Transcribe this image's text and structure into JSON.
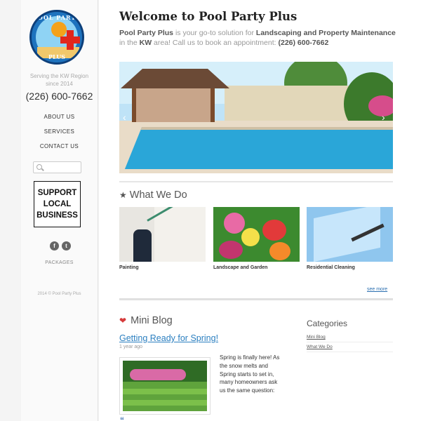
{
  "sidebar": {
    "logo": {
      "text_top": "POOL PARTY",
      "text_bottom": "PLUS"
    },
    "tagline_line1": "Serving the KW Region",
    "tagline_line2": "since 2014",
    "phone": "(226) 600-7662",
    "nav": [
      "ABOUT US",
      "SERVICES",
      "CONTACT US"
    ],
    "search_placeholder": "",
    "support_badge": [
      "SUPPORT",
      "LOCAL",
      "BUSINESS"
    ],
    "social": [
      {
        "icon": "facebook-icon",
        "glyph": "f"
      },
      {
        "icon": "twitter-icon",
        "glyph": "t"
      }
    ],
    "packages": "PACKAGES",
    "copyright": "2014 © Pool Party Plus"
  },
  "main": {
    "welcome": "Welcome to Pool Party Plus",
    "intro": {
      "brand": "Pool Party Plus",
      "part1": " is your go-to solution for ",
      "services": "Landscaping and Property Maintenance",
      "part2": " in the ",
      "region": "KW",
      "part3": " area! Call us to book an appointment: ",
      "phone": "(226) 600-7662"
    },
    "what_we_do": {
      "title": "What We Do",
      "cards": [
        "Painting",
        "Landscape and Garden",
        "Residential Cleaning"
      ],
      "see_more": "see more"
    },
    "mini_blog": {
      "title": "Mini Blog",
      "post_title": "Getting Ready for Spring!",
      "post_date": "1 year ago",
      "post_excerpt": "Spring is finally here! As the snow melts and Spring starts to set in, many homeowners ask us the same question:"
    },
    "categories": {
      "title": "Categories",
      "items": [
        "Mini Blog",
        "What We Do"
      ]
    }
  },
  "colors": {
    "accent_link": "#2b7fc0",
    "heart": "#d63a3a",
    "badge_border": "#111111"
  }
}
